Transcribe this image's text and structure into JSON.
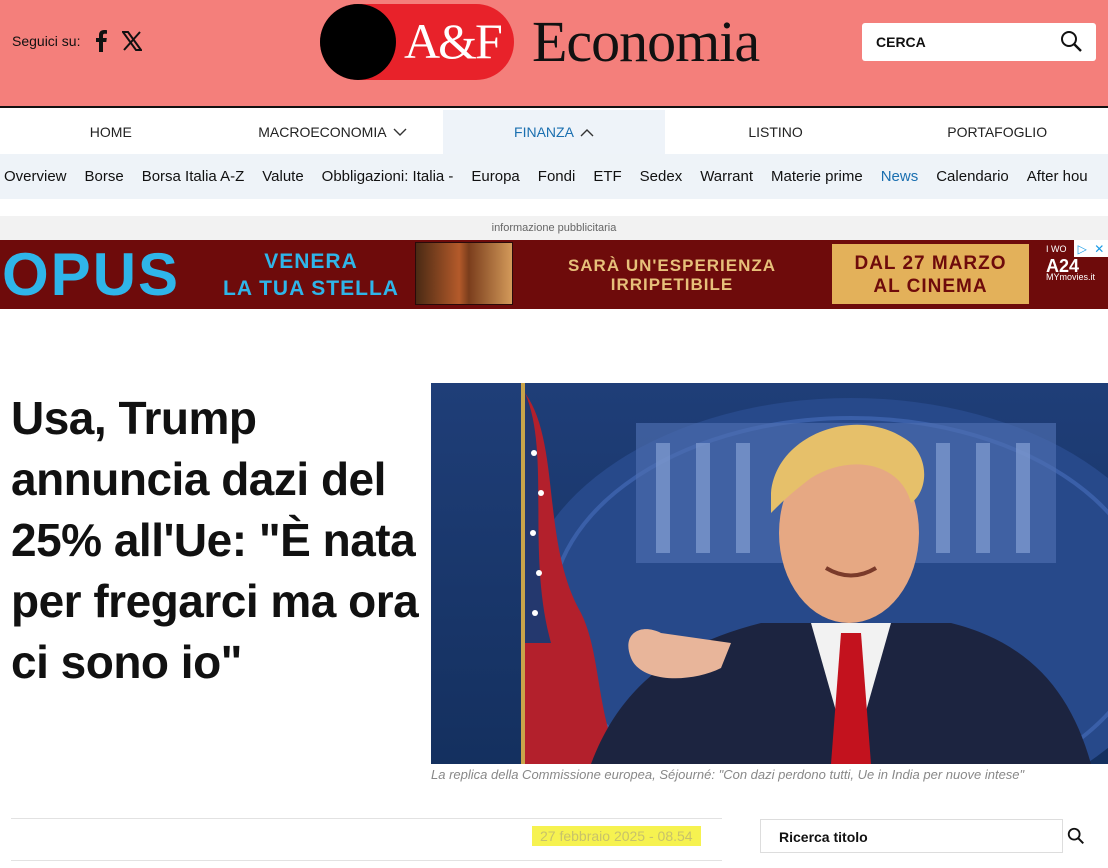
{
  "header": {
    "follow_label": "Seguici su:",
    "logo_text": "A&F",
    "brand": "Economia",
    "search_label": "CERCA",
    "colors": {
      "header_bg": "#f47f7b",
      "logo_red": "#e8222a",
      "accent_blue": "#1a6fb0"
    }
  },
  "nav": {
    "items": [
      {
        "label": "HOME"
      },
      {
        "label": "MACROECONOMIA"
      },
      {
        "label": "FINANZA"
      },
      {
        "label": "LISTINO"
      },
      {
        "label": "PORTAFOGLIO"
      }
    ],
    "active": "FINANZA"
  },
  "subnav": {
    "items": [
      "Overview",
      "Borse",
      "Borsa Italia A-Z",
      "Valute",
      "Obbligazioni: Italia -",
      "Europa",
      "Fondi",
      "ETF",
      "Sedex",
      "Warrant",
      "Materie prime",
      "News",
      "Calendario",
      "After hou"
    ],
    "active": "News"
  },
  "ad": {
    "label": "informazione pubblicitaria",
    "title": "OPUS",
    "tagline_1": "VENERA",
    "tagline_2": "LA TUA STELLA",
    "middle_1": "SARÀ UN'ESPERIENZA",
    "middle_2": "IRRIPETIBILE",
    "date_1": "DAL 27 MARZO",
    "date_2": "AL CINEMA",
    "brand_top": "I WO",
    "brand_mid": "A24",
    "brand_bottom": "MYmovies.it"
  },
  "article": {
    "headline": "Usa, Trump annuncia dazi del 25% all'Ue: \"È nata per fregarci ma ora ci sono io\"",
    "caption": "La replica della Commissione europea, Séjourné: \"Con dazi perdono tutti, Ue in India per nuove intese\"",
    "date": "27 febbraio 2025 - 08.54"
  },
  "sidebar": {
    "search_placeholder": "Ricerca titolo"
  }
}
